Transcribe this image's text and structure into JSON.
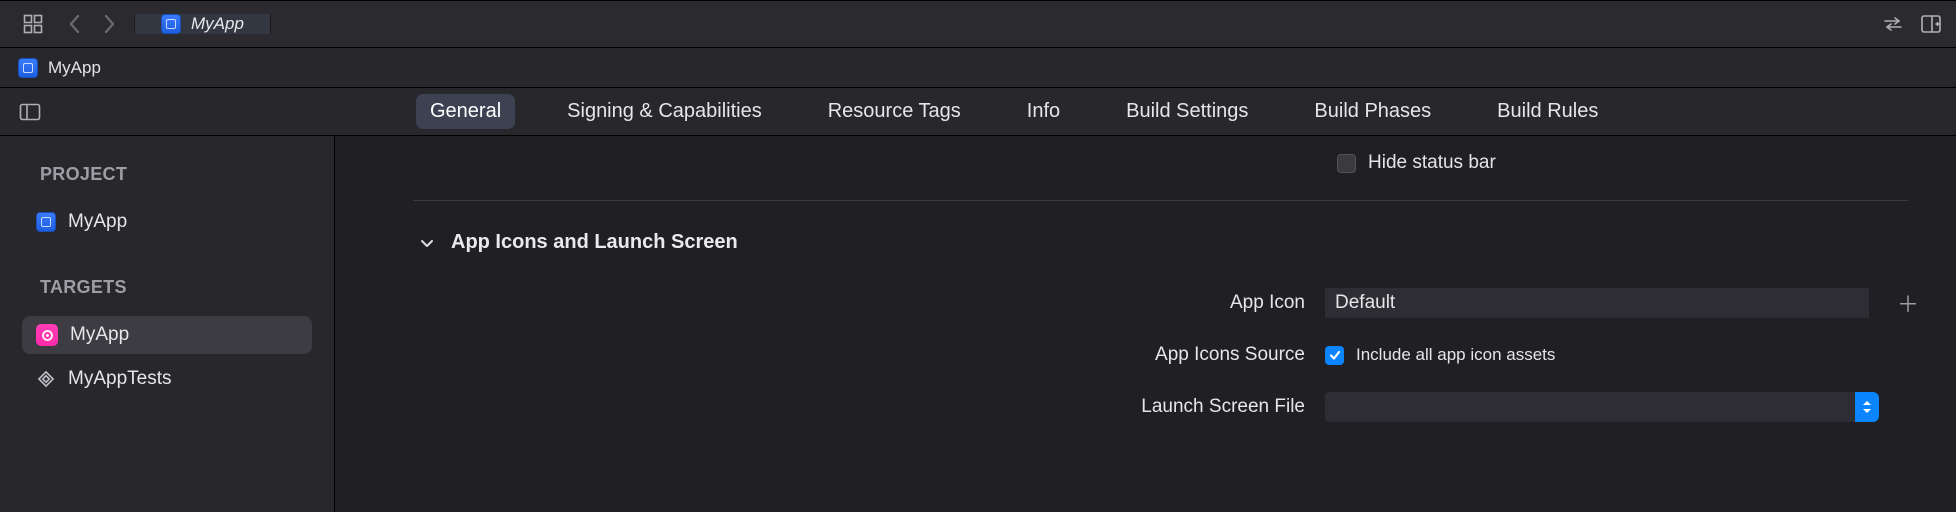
{
  "toolbar": {
    "tab_title": "MyApp"
  },
  "breadcrumb": {
    "title": "MyApp"
  },
  "settings_tabs": {
    "general": "General",
    "signing": "Signing & Capabilities",
    "resource": "Resource Tags",
    "info": "Info",
    "build_settings": "Build Settings",
    "build_phases": "Build Phases",
    "build_rules": "Build Rules"
  },
  "sidebar": {
    "project_heading": "PROJECT",
    "project_item": "MyApp",
    "targets_heading": "TARGETS",
    "targets": [
      {
        "name": "MyApp"
      },
      {
        "name": "MyAppTests"
      }
    ]
  },
  "content": {
    "hide_status_bar_label": "Hide status bar",
    "section_title": "App Icons and Launch Screen",
    "app_icon_label": "App Icon",
    "app_icon_value": "Default",
    "source_label": "App Icons Source",
    "include_all_label": "Include all app icon assets",
    "launch_file_label": "Launch Screen File",
    "launch_file_value": ""
  }
}
